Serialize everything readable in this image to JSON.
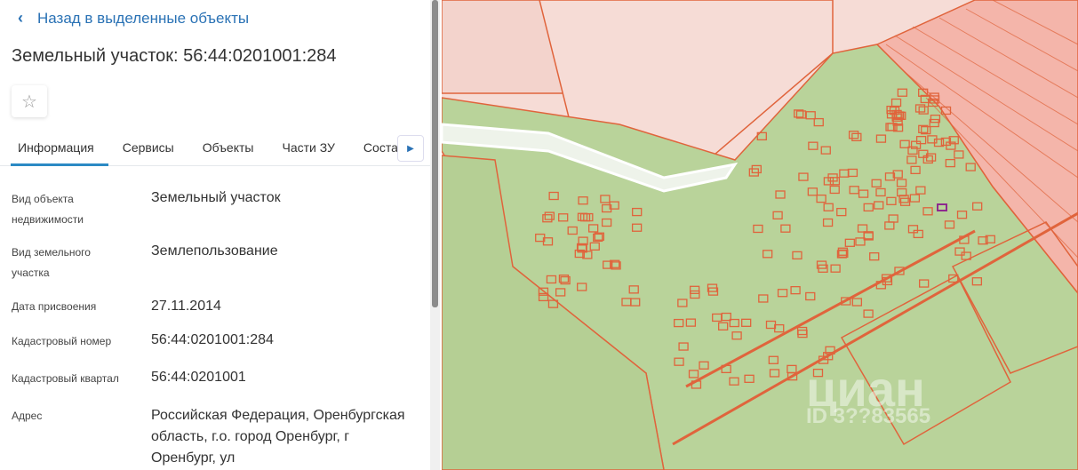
{
  "panel": {
    "back_label": "Назад в выделенные объекты",
    "title": "Земельный участок: 56:44:0201001:284",
    "favorite_icon": "star-outline-icon",
    "tabs": [
      {
        "label": "Информация",
        "active": true
      },
      {
        "label": "Сервисы"
      },
      {
        "label": "Объекты"
      },
      {
        "label": "Части ЗУ"
      },
      {
        "label": "Соста"
      }
    ],
    "tabs_next_icon": "triangle-right-icon",
    "fields": [
      {
        "label": "Вид объекта недвижимости",
        "value": "Земельный участок"
      },
      {
        "label": "Вид земельного участка",
        "value": "Землепользование"
      },
      {
        "label": "Дата присвоения",
        "value": "27.11.2014"
      },
      {
        "label": "Кадастровый номер",
        "value": "56:44:0201001:284"
      },
      {
        "label": "Кадастровый квартал",
        "value": "56:44:0201001"
      },
      {
        "label": "Адрес",
        "value": "Российская Федерация, Оренбургская область, г.о. город Оренбург, г Оренбург, ул"
      }
    ]
  },
  "map": {
    "watermark": "циан",
    "watermark_id": "ID 3??83565",
    "colors": {
      "plot_fill": "#b9d39a",
      "border": "#e0643c",
      "background": "#f6dcd6",
      "selected": "#8e2a8e"
    }
  }
}
